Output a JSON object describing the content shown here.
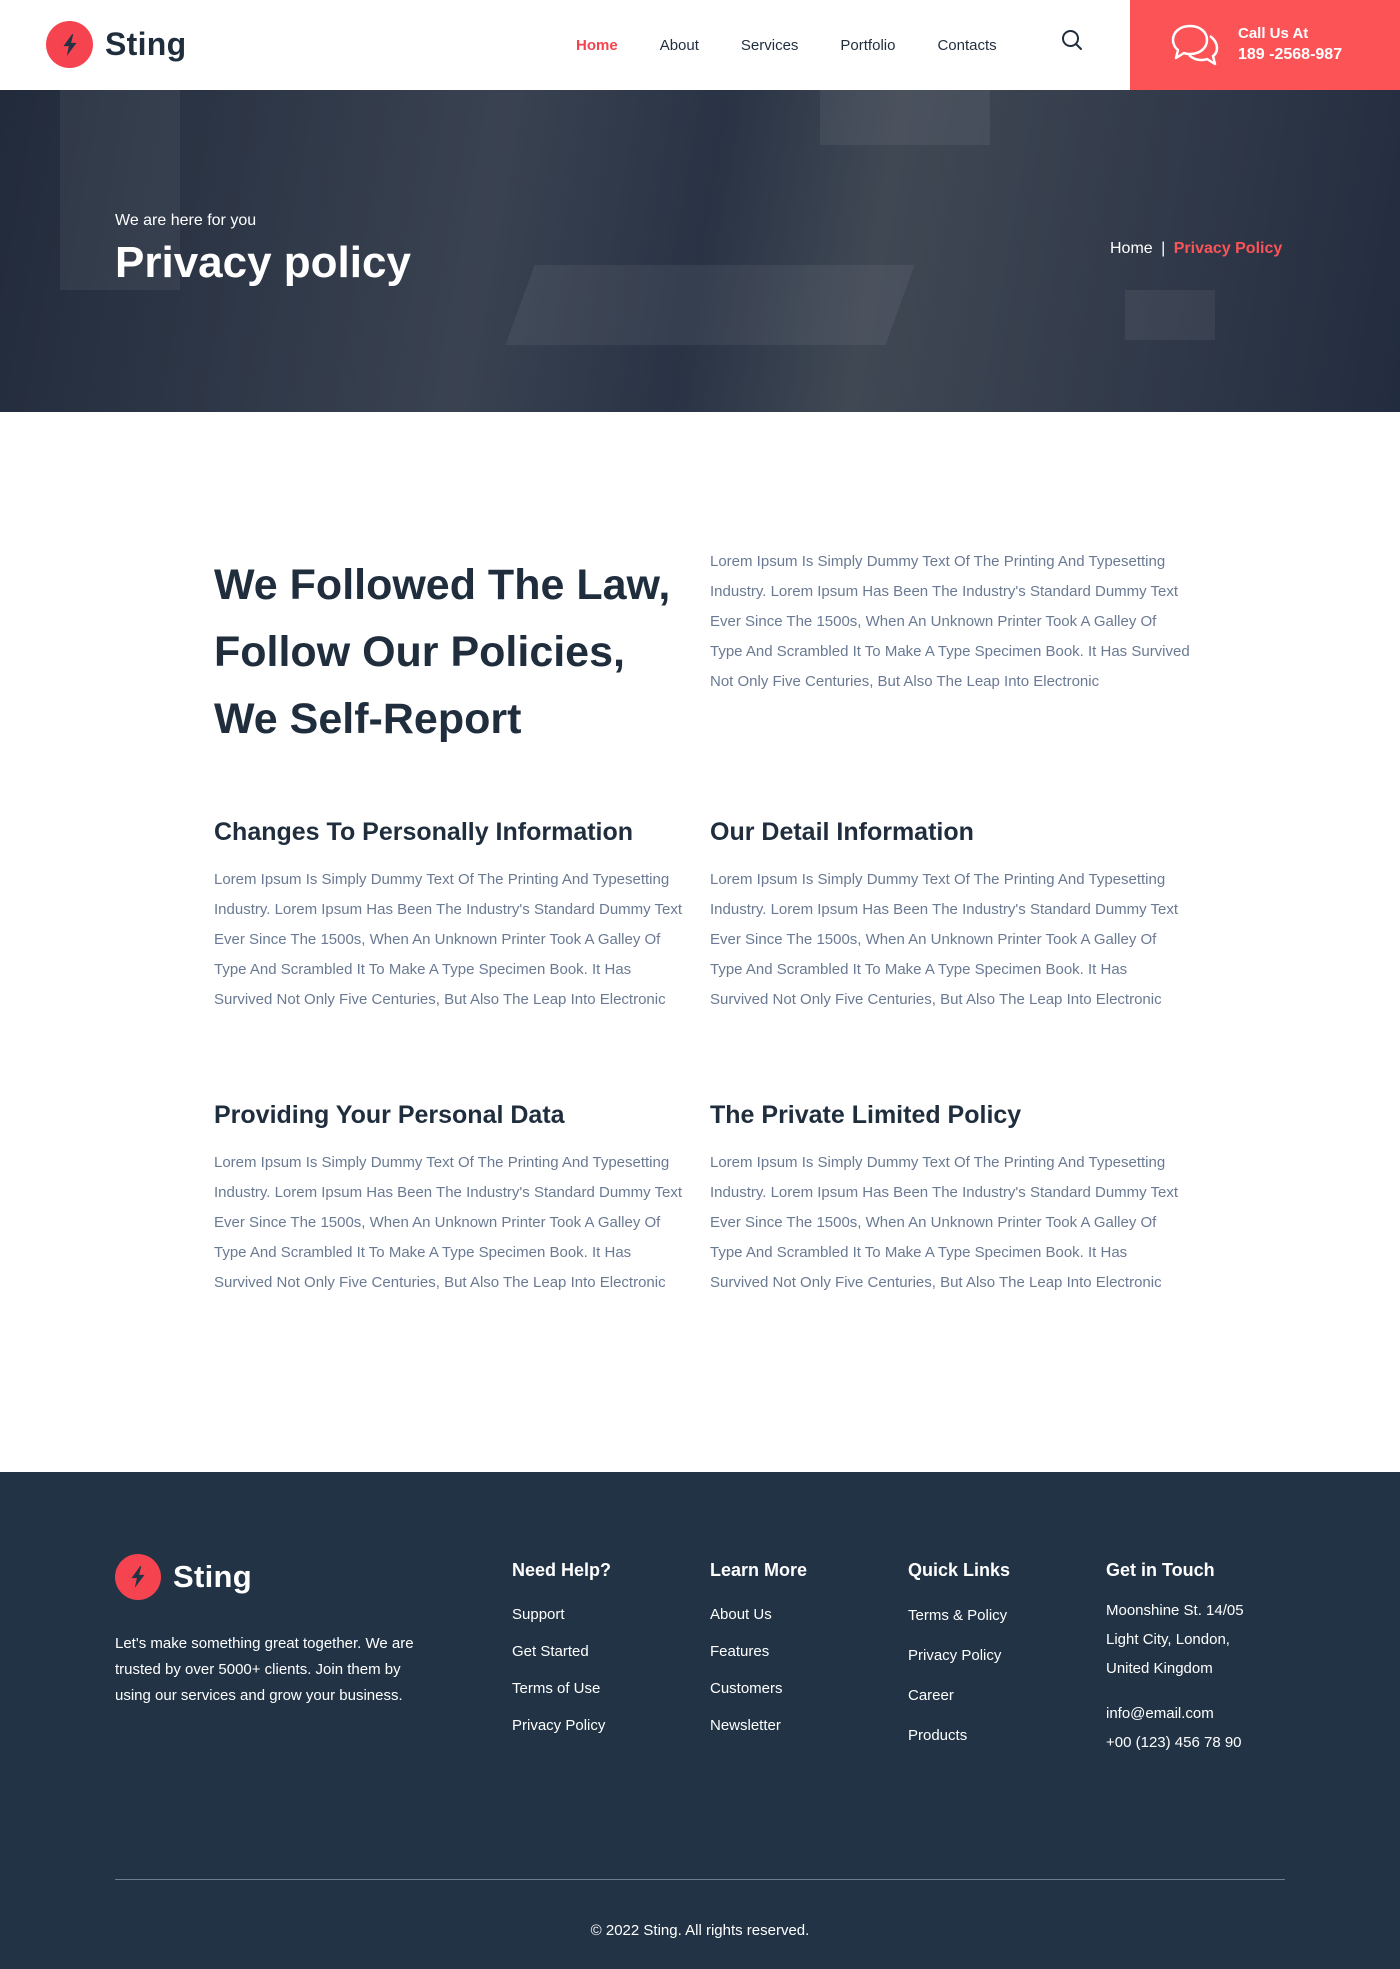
{
  "brand": {
    "name": "Sting",
    "accent": "#fc5357",
    "dark": "#213345"
  },
  "nav": {
    "items": [
      {
        "label": "Home",
        "active": true
      },
      {
        "label": "About",
        "active": false
      },
      {
        "label": "Services",
        "active": false
      },
      {
        "label": "Portfolio",
        "active": false
      },
      {
        "label": "Contacts",
        "active": false
      }
    ],
    "search_icon": "search-icon"
  },
  "call": {
    "label": "Call Us At",
    "number": "189 -2568-987",
    "icon": "chat-bubbles-icon"
  },
  "hero": {
    "subtitle": "We are here for you",
    "title": "Privacy policy",
    "breadcrumb": {
      "home": "Home",
      "separator": "|",
      "current": "Privacy Policy"
    }
  },
  "intro": {
    "title": "We Followed The Law, Follow Our Policies, We Self-Report",
    "text": "Lorem Ipsum Is Simply Dummy Text Of The Printing And Typesetting Industry. Lorem Ipsum Has Been The Industry's Standard Dummy Text Ever Since The 1500s, When An Unknown Printer Took A Galley Of Type And Scrambled It To Make A Type Specimen Book. It Has Survived Not Only Five Centuries, But Also The Leap Into Electronic"
  },
  "sections": [
    {
      "title": "Changes To Personally Information",
      "text": "Lorem Ipsum Is Simply Dummy Text Of The Printing And Typesetting Industry. Lorem Ipsum Has Been The Industry's Standard Dummy Text Ever Since The 1500s, When An Unknown Printer Took A Galley Of Type And Scrambled It To Make A Type Specimen Book. It Has Survived Not Only Five Centuries, But Also The Leap Into Electronic"
    },
    {
      "title": "Our Detail Information",
      "text": "Lorem Ipsum Is Simply Dummy Text Of The Printing And Typesetting Industry. Lorem Ipsum Has Been The Industry's Standard Dummy Text Ever Since The 1500s, When An Unknown Printer Took A Galley Of Type And Scrambled It To Make A Type Specimen Book. It Has Survived Not Only Five Centuries, But Also The Leap Into Electronic"
    },
    {
      "title": "Providing Your Personal Data",
      "text": "Lorem Ipsum Is Simply Dummy Text Of The Printing And Typesetting Industry. Lorem Ipsum Has Been The Industry's Standard Dummy Text Ever Since The 1500s, When An Unknown Printer Took A Galley Of Type And Scrambled It To Make A Type Specimen Book. It Has Survived Not Only Five Centuries, But Also The Leap Into Electronic"
    },
    {
      "title": "The Private Limited Policy",
      "text": "Lorem Ipsum Is Simply Dummy Text Of The Printing And Typesetting Industry. Lorem Ipsum Has Been The Industry's Standard Dummy Text Ever Since The 1500s, When An Unknown Printer Took A Galley Of Type And Scrambled It To Make A Type Specimen Book. It Has Survived Not Only Five Centuries, But Also The Leap Into Electronic"
    }
  ],
  "footer": {
    "about": "Let's make something great together. We are trusted by over 5000+ clients. Join them by using our services and grow your business.",
    "columns": [
      {
        "title": "Need Help?",
        "links": [
          "Support",
          "Get Started",
          "Terms of Use",
          "Privacy Policy"
        ]
      },
      {
        "title": "Learn More",
        "links": [
          "About Us",
          "Features",
          "Customers",
          "Newsletter"
        ]
      },
      {
        "title": "Quick Links",
        "links": [
          "Terms & Policy",
          "Privacy Policy",
          "Career",
          "Products"
        ]
      }
    ],
    "contact": {
      "title": "Get in Touch",
      "address": [
        "Moonshine St. 14/05",
        "Light City, London,",
        "United Kingdom"
      ],
      "email": "info@email.com",
      "phone": "+00 (123) 456 78 90"
    },
    "copyright": "© 2022 Sting. All rights reserved."
  }
}
